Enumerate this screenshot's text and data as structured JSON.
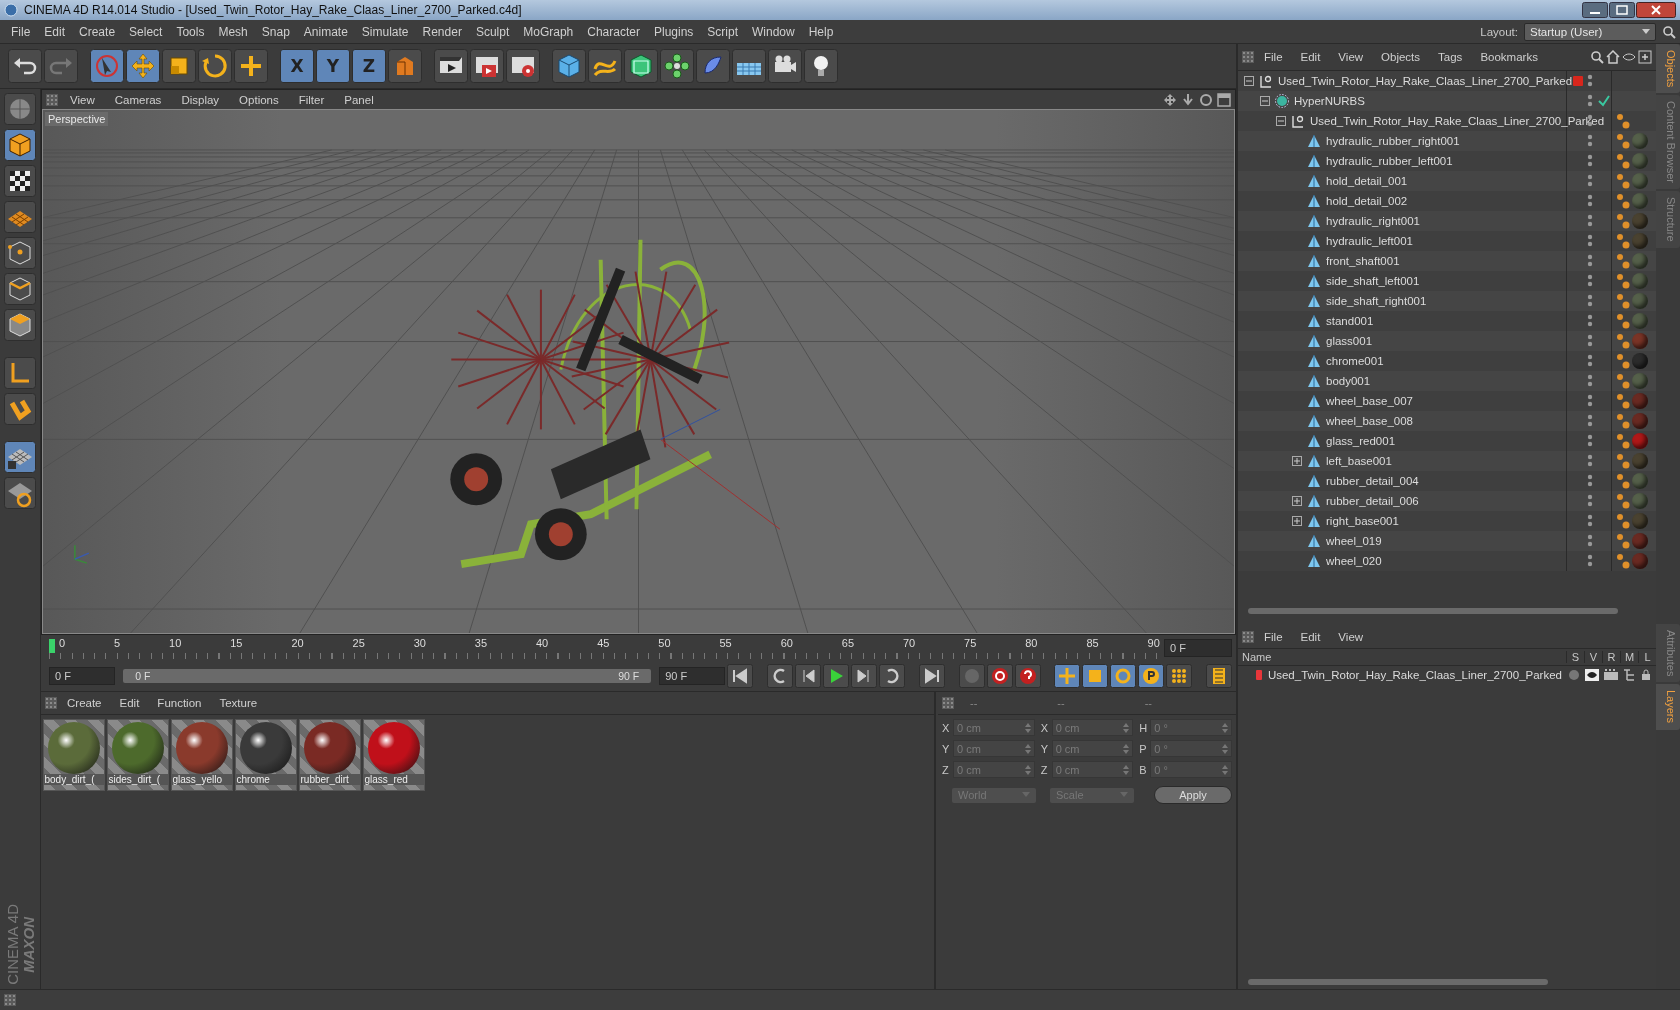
{
  "window": {
    "title": "CINEMA 4D R14.014 Studio - [Used_Twin_Rotor_Hay_Rake_Claas_Liner_2700_Parked.c4d]"
  },
  "menu_bar": [
    "File",
    "Edit",
    "Create",
    "Select",
    "Tools",
    "Mesh",
    "Snap",
    "Animate",
    "Simulate",
    "Render",
    "Sculpt",
    "MoGraph",
    "Character",
    "Plugins",
    "Script",
    "Window",
    "Help"
  ],
  "layout": {
    "label": "Layout:",
    "value": "Startup (User)"
  },
  "axis_buttons": [
    {
      "label": "X",
      "on": true
    },
    {
      "label": "Y",
      "on": true
    },
    {
      "label": "Z",
      "on": true
    }
  ],
  "viewport": {
    "menu": [
      "View",
      "Cameras",
      "Display",
      "Options",
      "Filter",
      "Panel"
    ],
    "camera_label": "Perspective"
  },
  "timeline": {
    "ruler_labels": [
      "0",
      "5",
      "10",
      "15",
      "20",
      "25",
      "30",
      "35",
      "40",
      "45",
      "50",
      "55",
      "60",
      "65",
      "70",
      "75",
      "80",
      "85",
      "90"
    ],
    "level": 0,
    "current_frame": "0 F",
    "start_field": "0 F",
    "range": {
      "start": "0 F",
      "end": "90 F",
      "level": 1
    },
    "end_field": "90 F"
  },
  "materials": {
    "menu": [
      "Create",
      "Edit",
      "Function",
      "Texture"
    ],
    "items": [
      {
        "name": "body_dirt_(",
        "color": "#5b6b3a"
      },
      {
        "name": "sides_dirt_(",
        "color": "#4d6a2c"
      },
      {
        "name": "glass_yello",
        "color": "#8a3a2c"
      },
      {
        "name": "chrome",
        "color": "#3a3a3a"
      },
      {
        "name": "rubber_dirt",
        "color": "#7a2a24"
      },
      {
        "name": "glass_red",
        "color": "#c0101a"
      }
    ]
  },
  "coordinates": {
    "disabled": true,
    "headers": [
      "--",
      "--",
      "--"
    ],
    "rows": [
      [
        {
          "label": "X",
          "value": "0 cm"
        },
        {
          "label": "X",
          "value": "0 cm"
        },
        {
          "label": "H",
          "value": "0 °"
        }
      ],
      [
        {
          "label": "Y",
          "value": "0 cm"
        },
        {
          "label": "Y",
          "value": "0 cm"
        },
        {
          "label": "P",
          "value": "0 °"
        }
      ],
      [
        {
          "label": "Z",
          "value": "0 cm"
        },
        {
          "label": "Z",
          "value": "0 cm"
        },
        {
          "label": "B",
          "value": "0 °"
        }
      ]
    ],
    "dropdowns": [
      "World",
      "Scale"
    ],
    "apply": "Apply"
  },
  "object_manager": {
    "menu": [
      "File",
      "Edit",
      "View",
      "Objects",
      "Tags",
      "Bookmarks"
    ],
    "tree": [
      {
        "name": "Used_Twin_Rotor_Hay_Rake_Claas_Liner_2700_Parked",
        "kind": "null",
        "expanded": true,
        "layer": {
          "color": "#d8261c"
        },
        "children": [
          {
            "name": "HyperNURBS",
            "kind": "hypernurbs",
            "expanded": true,
            "enabled": true,
            "children": [
              {
                "name": "Used_Twin_Rotor_Hay_Rake_Claas_Liner_2700_Parked",
                "kind": "null",
                "expanded": true,
                "phong": true,
                "children": [
                  {
                    "name": "hydraulic_rubber_right001",
                    "kind": "polygon",
                    "phong": true,
                    "material_tag": {
                      "color": "#55604a"
                    }
                  },
                  {
                    "name": "hydraulic_rubber_left001",
                    "kind": "polygon",
                    "phong": true,
                    "material_tag": {
                      "color": "#55604a"
                    }
                  },
                  {
                    "name": "hold_detail_001",
                    "kind": "polygon",
                    "phong": true,
                    "material_tag": {
                      "color": "#55604a"
                    }
                  },
                  {
                    "name": "hold_detail_002",
                    "kind": "polygon",
                    "phong": true,
                    "material_tag": {
                      "color": "#55604a"
                    }
                  },
                  {
                    "name": "hydraulic_right001",
                    "kind": "polygon",
                    "phong": true,
                    "material_tag": {
                      "color": "#4a4230"
                    }
                  },
                  {
                    "name": "hydraulic_left001",
                    "kind": "polygon",
                    "phong": true,
                    "material_tag": {
                      "color": "#4a4230"
                    }
                  },
                  {
                    "name": "front_shaft001",
                    "kind": "polygon",
                    "phong": true,
                    "material_tag": {
                      "color": "#55604a"
                    }
                  },
                  {
                    "name": "side_shaft_left001",
                    "kind": "polygon",
                    "phong": true,
                    "material_tag": {
                      "color": "#55604a"
                    }
                  },
                  {
                    "name": "side_shaft_right001",
                    "kind": "polygon",
                    "phong": true,
                    "material_tag": {
                      "color": "#55604a"
                    }
                  },
                  {
                    "name": "stand001",
                    "kind": "polygon",
                    "phong": true,
                    "material_tag": {
                      "color": "#55604a"
                    }
                  },
                  {
                    "name": "glass001",
                    "kind": "polygon",
                    "phong": true,
                    "material_tag": {
                      "color": "#7a3426"
                    }
                  },
                  {
                    "name": "chrome001",
                    "kind": "polygon",
                    "phong": true,
                    "material_tag": {
                      "color": "#2c2c2c"
                    }
                  },
                  {
                    "name": "body001",
                    "kind": "polygon",
                    "phong": true,
                    "material_tag": {
                      "color": "#55604a"
                    }
                  },
                  {
                    "name": "wheel_base_007",
                    "kind": "polygon",
                    "phong": true,
                    "material_tag": {
                      "color": "#6a2a22"
                    }
                  },
                  {
                    "name": "wheel_base_008",
                    "kind": "polygon",
                    "phong": true,
                    "material_tag": {
                      "color": "#6a2a22"
                    }
                  },
                  {
                    "name": "glass_red001",
                    "kind": "polygon",
                    "phong": true,
                    "material_tag": {
                      "color": "#b01818"
                    }
                  },
                  {
                    "name": "left_base001",
                    "kind": "polygon",
                    "expanded": false,
                    "phong": true,
                    "material_tag": {
                      "color": "#4a4230"
                    }
                  },
                  {
                    "name": "rubber_detail_004",
                    "kind": "polygon",
                    "phong": true,
                    "material_tag": {
                      "color": "#55604a"
                    }
                  },
                  {
                    "name": "rubber_detail_006",
                    "kind": "polygon",
                    "expanded": false,
                    "phong": true,
                    "material_tag": {
                      "color": "#55604a"
                    }
                  },
                  {
                    "name": "right_base001",
                    "kind": "polygon",
                    "expanded": false,
                    "phong": true,
                    "material_tag": {
                      "color": "#4a4230"
                    }
                  },
                  {
                    "name": "wheel_019",
                    "kind": "polygon",
                    "phong": true,
                    "material_tag": {
                      "color": "#6a2a22"
                    }
                  },
                  {
                    "name": "wheel_020",
                    "kind": "polygon",
                    "phong": true,
                    "material_tag": {
                      "color": "#6a2a22"
                    }
                  }
                ]
              }
            ]
          }
        ]
      }
    ]
  },
  "side_tabs_top": [
    {
      "label": "Objects",
      "selected": true
    },
    {
      "label": "Content Browser",
      "selected": false
    },
    {
      "label": "Structure",
      "selected": false
    }
  ],
  "layer_manager": {
    "menu": [
      "File",
      "Edit",
      "View"
    ],
    "columns": [
      "Name",
      "S",
      "V",
      "R",
      "M",
      "L"
    ],
    "layers": [
      {
        "name": "Used_Twin_Rotor_Hay_Rake_Claas_Liner_2700_Parked",
        "color": "#e8363a"
      }
    ]
  },
  "side_tabs_bottom": [
    {
      "label": "Attributes",
      "selected": false
    },
    {
      "label": "Layers",
      "selected": true
    }
  ],
  "logo": {
    "brand": "MAXON",
    "product": "CINEMA 4D"
  }
}
